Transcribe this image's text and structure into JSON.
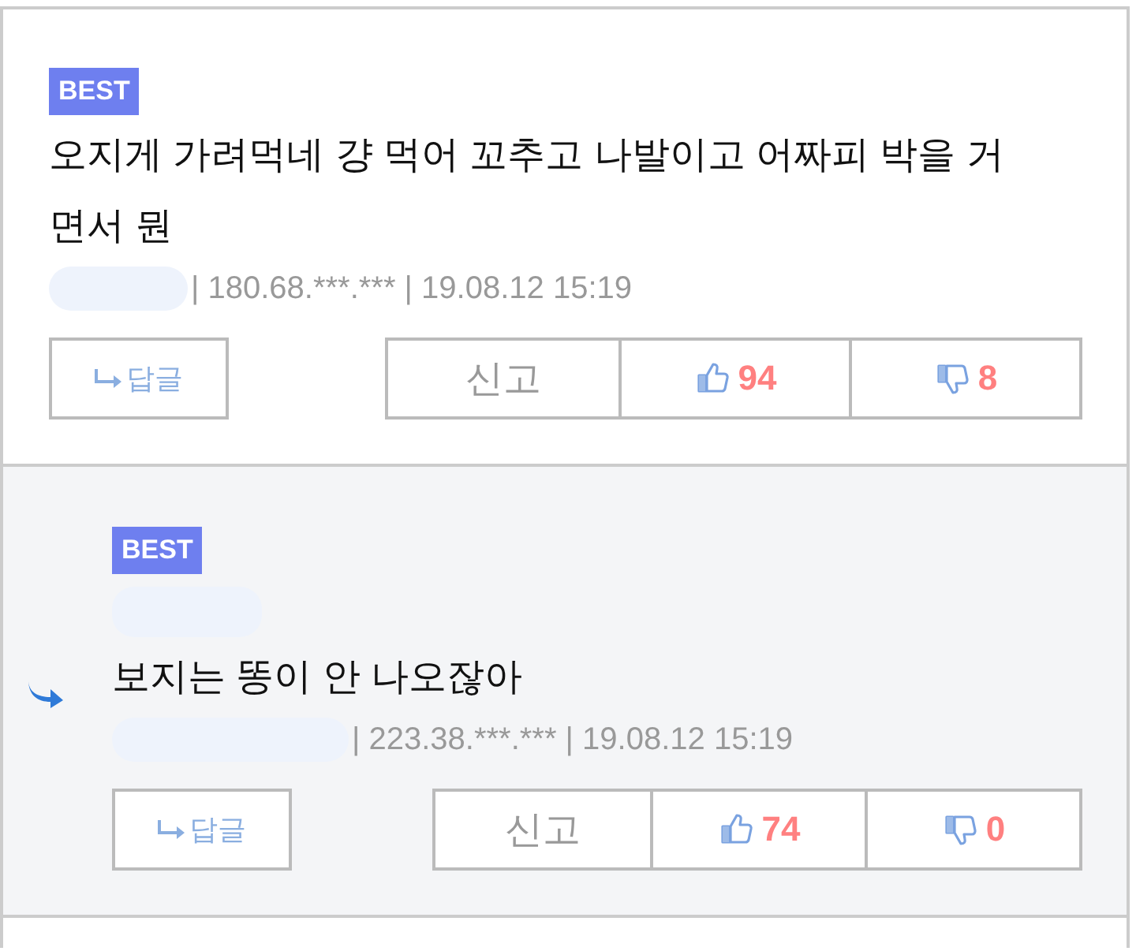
{
  "comments": [
    {
      "badge": "BEST",
      "reply": false,
      "name_above": false,
      "text": "오지게 가려먹네 걍 먹어 꼬추고 나발이고 어짜피 박을 거면서 뭔",
      "meta": "| 180.68.***.*** | 19.08.12 15:19",
      "reply_button": "답글",
      "report": "신고",
      "likes": "94",
      "dislikes": "8"
    },
    {
      "badge": "BEST",
      "reply": true,
      "name_above": true,
      "text": "보지는 똥이 안 나오잖아",
      "meta": "| 223.38.***.*** | 19.08.12 15:19",
      "reply_button": "답글",
      "report": "신고",
      "likes": "74",
      "dislikes": "0"
    }
  ]
}
